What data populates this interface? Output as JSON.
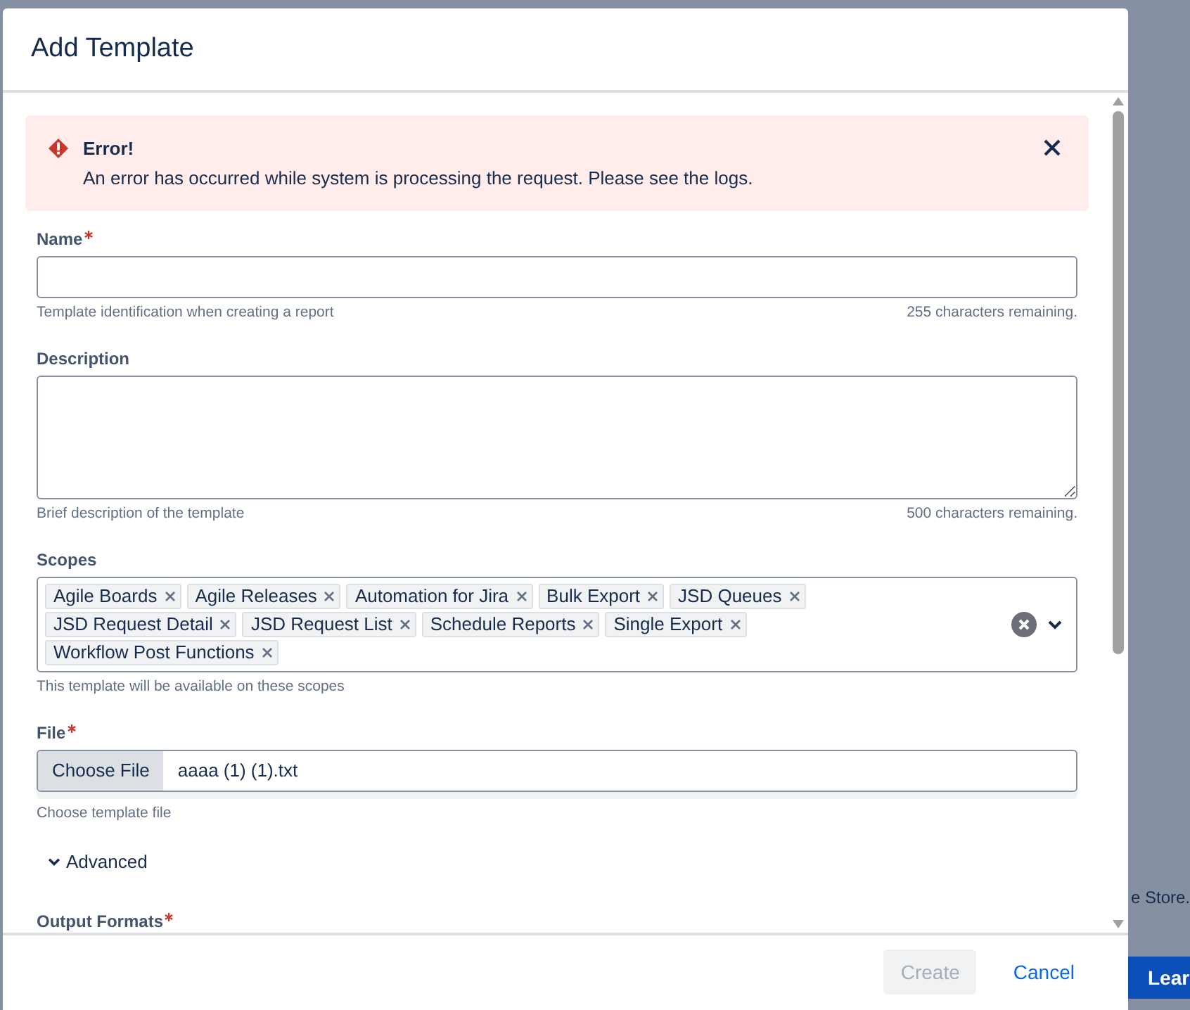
{
  "background": {
    "link_text": "e Store.",
    "button": "Lear"
  },
  "dialog": {
    "title": "Add Template"
  },
  "alert": {
    "title": "Error!",
    "message": "An error has occurred while system is processing the request. Please see the logs."
  },
  "fields": [
    {
      "kind": "text",
      "label": "Name",
      "required": true,
      "help": "Template identification when creating a report",
      "counter": "255 characters remaining."
    },
    {
      "kind": "textarea",
      "label": "Description",
      "required": false,
      "help": "Brief description of the template",
      "counter": "500 characters remaining."
    },
    {
      "kind": "multiselect",
      "label": "Scopes",
      "required": false,
      "tags": [
        "Agile Boards",
        "Agile Releases",
        "Automation for Jira",
        "Bulk Export",
        "JSD Queues",
        "JSD Request Detail",
        "JSD Request List",
        "Schedule Reports",
        "Single Export",
        "Workflow Post Functions"
      ],
      "help": "This template will be available on these scopes"
    },
    {
      "kind": "file",
      "label": "File",
      "required": true,
      "button": "Choose File",
      "value": "aaaa (1) (1).txt",
      "help": "Choose template file"
    }
  ],
  "advanced": {
    "label": "Advanced"
  },
  "output_formats": {
    "label": "Output Formats",
    "required": true
  },
  "footer": {
    "buttons": [
      {
        "kind": "primary",
        "label": "Create",
        "disabled": true
      },
      {
        "kind": "subtle",
        "label": "Cancel",
        "disabled": false
      }
    ]
  }
}
